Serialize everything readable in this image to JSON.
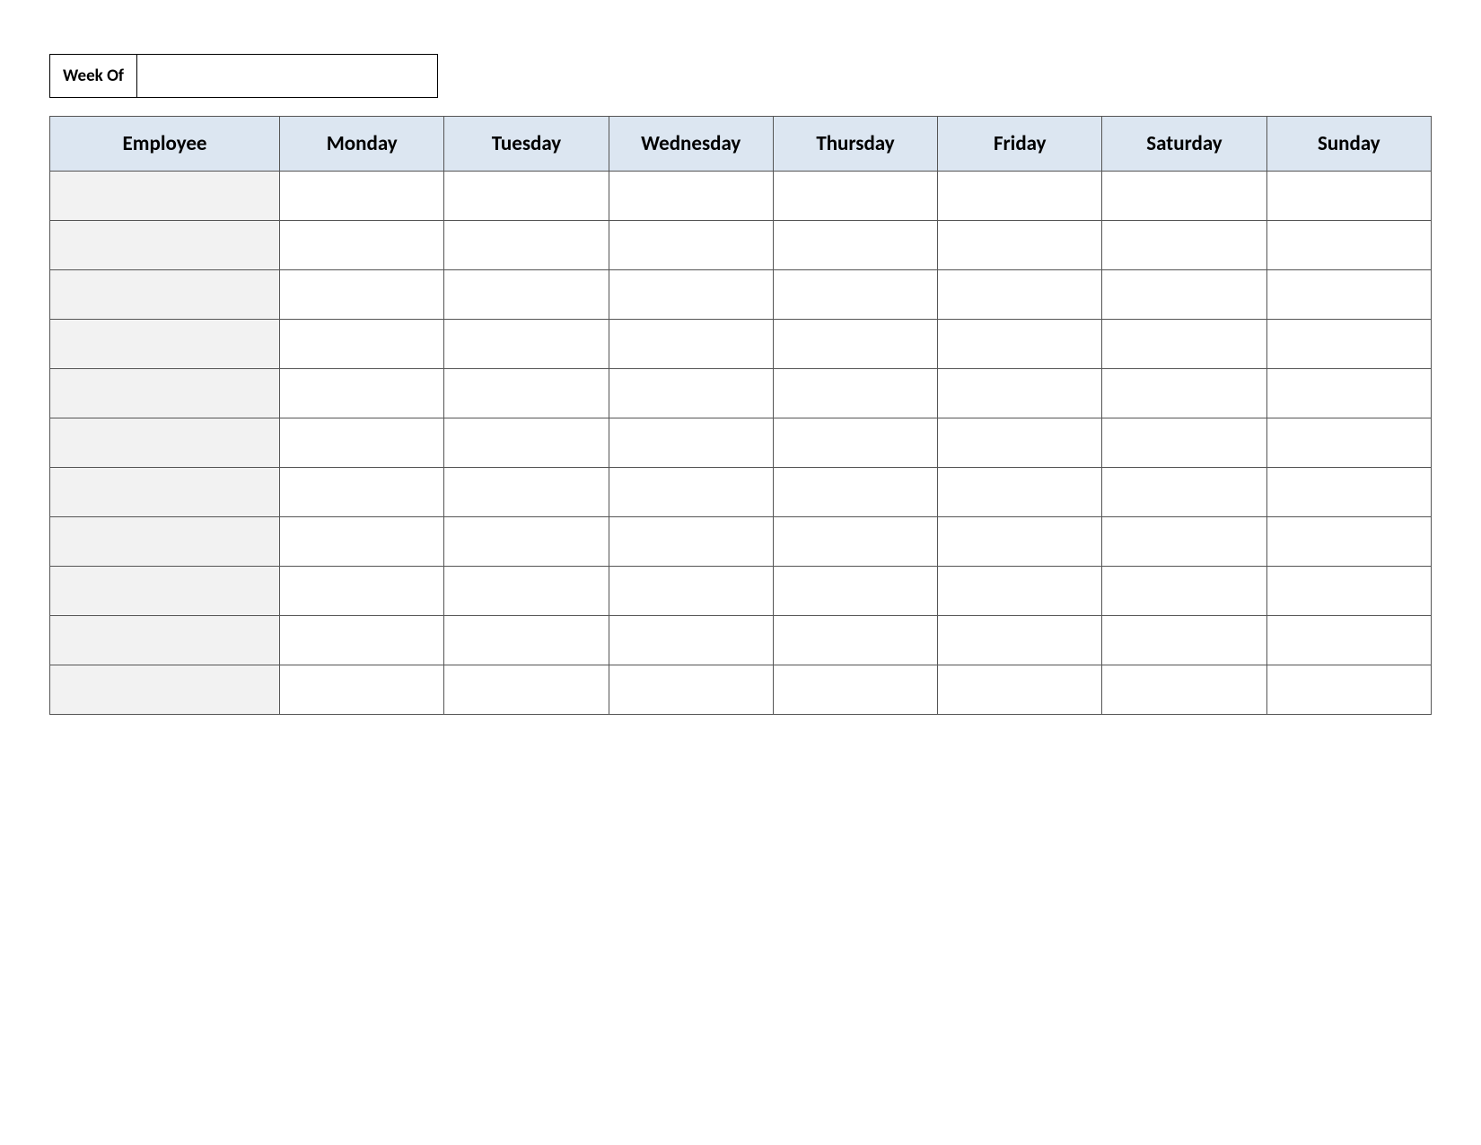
{
  "week_of": {
    "label": "Week Of",
    "value": ""
  },
  "headers": {
    "employee": "Employee",
    "days": [
      "Monday",
      "Tuesday",
      "Wednesday",
      "Thursday",
      "Friday",
      "Saturday",
      "Sunday"
    ]
  },
  "rows": [
    {
      "employee": "",
      "mon": "",
      "tue": "",
      "wed": "",
      "thu": "",
      "fri": "",
      "sat": "",
      "sun": ""
    },
    {
      "employee": "",
      "mon": "",
      "tue": "",
      "wed": "",
      "thu": "",
      "fri": "",
      "sat": "",
      "sun": ""
    },
    {
      "employee": "",
      "mon": "",
      "tue": "",
      "wed": "",
      "thu": "",
      "fri": "",
      "sat": "",
      "sun": ""
    },
    {
      "employee": "",
      "mon": "",
      "tue": "",
      "wed": "",
      "thu": "",
      "fri": "",
      "sat": "",
      "sun": ""
    },
    {
      "employee": "",
      "mon": "",
      "tue": "",
      "wed": "",
      "thu": "",
      "fri": "",
      "sat": "",
      "sun": ""
    },
    {
      "employee": "",
      "mon": "",
      "tue": "",
      "wed": "",
      "thu": "",
      "fri": "",
      "sat": "",
      "sun": ""
    },
    {
      "employee": "",
      "mon": "",
      "tue": "",
      "wed": "",
      "thu": "",
      "fri": "",
      "sat": "",
      "sun": ""
    },
    {
      "employee": "",
      "mon": "",
      "tue": "",
      "wed": "",
      "thu": "",
      "fri": "",
      "sat": "",
      "sun": ""
    },
    {
      "employee": "",
      "mon": "",
      "tue": "",
      "wed": "",
      "thu": "",
      "fri": "",
      "sat": "",
      "sun": ""
    },
    {
      "employee": "",
      "mon": "",
      "tue": "",
      "wed": "",
      "thu": "",
      "fri": "",
      "sat": "",
      "sun": ""
    },
    {
      "employee": "",
      "mon": "",
      "tue": "",
      "wed": "",
      "thu": "",
      "fri": "",
      "sat": "",
      "sun": ""
    }
  ]
}
